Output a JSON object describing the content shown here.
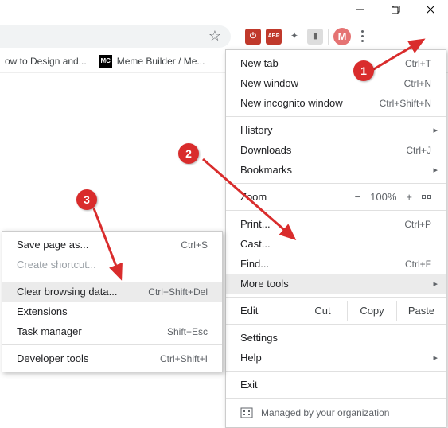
{
  "window_controls": {
    "minimize": "minimize",
    "restore": "restore",
    "close": "close"
  },
  "omnibox": {
    "star_title": "Bookmark this tab",
    "avatar_letter": "M"
  },
  "extensions": [
    {
      "name": "ublock",
      "glyph": "🛡"
    },
    {
      "name": "abp",
      "glyph": "ABP"
    },
    {
      "name": "clip",
      "glyph": "✂"
    },
    {
      "name": "note",
      "glyph": "▮"
    }
  ],
  "bookmarks": [
    {
      "label": "ow to Design and...",
      "icon": ""
    },
    {
      "label": "Meme Builder / Me...",
      "icon": "MC"
    }
  ],
  "menu": {
    "new_tab": {
      "label": "New tab",
      "shortcut": "Ctrl+T"
    },
    "new_window": {
      "label": "New window",
      "shortcut": "Ctrl+N"
    },
    "incognito": {
      "label": "New incognito window",
      "shortcut": "Ctrl+Shift+N"
    },
    "history": {
      "label": "History"
    },
    "downloads": {
      "label": "Downloads",
      "shortcut": "Ctrl+J"
    },
    "bookmarks": {
      "label": "Bookmarks"
    },
    "zoom": {
      "label": "Zoom",
      "minus": "−",
      "value": "100%",
      "plus": "+"
    },
    "print": {
      "label": "Print...",
      "shortcut": "Ctrl+P"
    },
    "cast": {
      "label": "Cast..."
    },
    "find": {
      "label": "Find...",
      "shortcut": "Ctrl+F"
    },
    "more_tools": {
      "label": "More tools"
    },
    "edit": {
      "label": "Edit",
      "cut": "Cut",
      "copy": "Copy",
      "paste": "Paste"
    },
    "settings": {
      "label": "Settings"
    },
    "help": {
      "label": "Help"
    },
    "exit": {
      "label": "Exit"
    },
    "managed": {
      "label": "Managed by your organization"
    }
  },
  "submenu": {
    "save_page": {
      "label": "Save page as...",
      "shortcut": "Ctrl+S"
    },
    "create_shortcut": {
      "label": "Create shortcut..."
    },
    "clear_browsing": {
      "label": "Clear browsing data...",
      "shortcut": "Ctrl+Shift+Del"
    },
    "extensions": {
      "label": "Extensions"
    },
    "task_manager": {
      "label": "Task manager",
      "shortcut": "Shift+Esc"
    },
    "dev_tools": {
      "label": "Developer tools",
      "shortcut": "Ctrl+Shift+I"
    }
  },
  "annotations": {
    "step1": "1",
    "step2": "2",
    "step3": "3"
  }
}
